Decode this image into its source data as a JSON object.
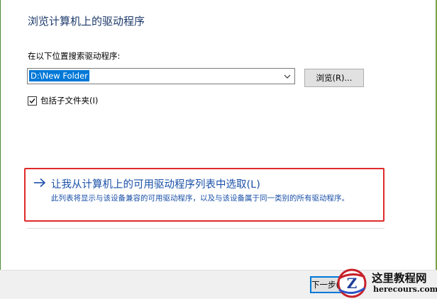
{
  "page": {
    "title": "浏览计算机上的驱动程序"
  },
  "search": {
    "label": "在以下位置搜索驱动程序:",
    "path_value": "D:\\New Folder",
    "browse_label": "浏览(R)...",
    "dropdown_icon": "chevron-down-icon"
  },
  "options": {
    "include_subfolders_label": "包括子文件夹(I)",
    "include_subfolders_checked": true
  },
  "pick_from_list": {
    "title": "让我从计算机上的可用驱动程序列表中选取(L)",
    "description": "此列表将显示与该设备兼容的可用驱动程序，以及与该设备属于同一类别的所有驱动程序。",
    "icon": "arrow-right-icon",
    "highlight_color": "#e02a2a",
    "link_color": "#1a50a8"
  },
  "footer": {
    "next_label": "下一步(N)"
  },
  "watermark": {
    "name": "这里教程网",
    "domain": "herecours.com",
    "logo_letter": "Z"
  }
}
